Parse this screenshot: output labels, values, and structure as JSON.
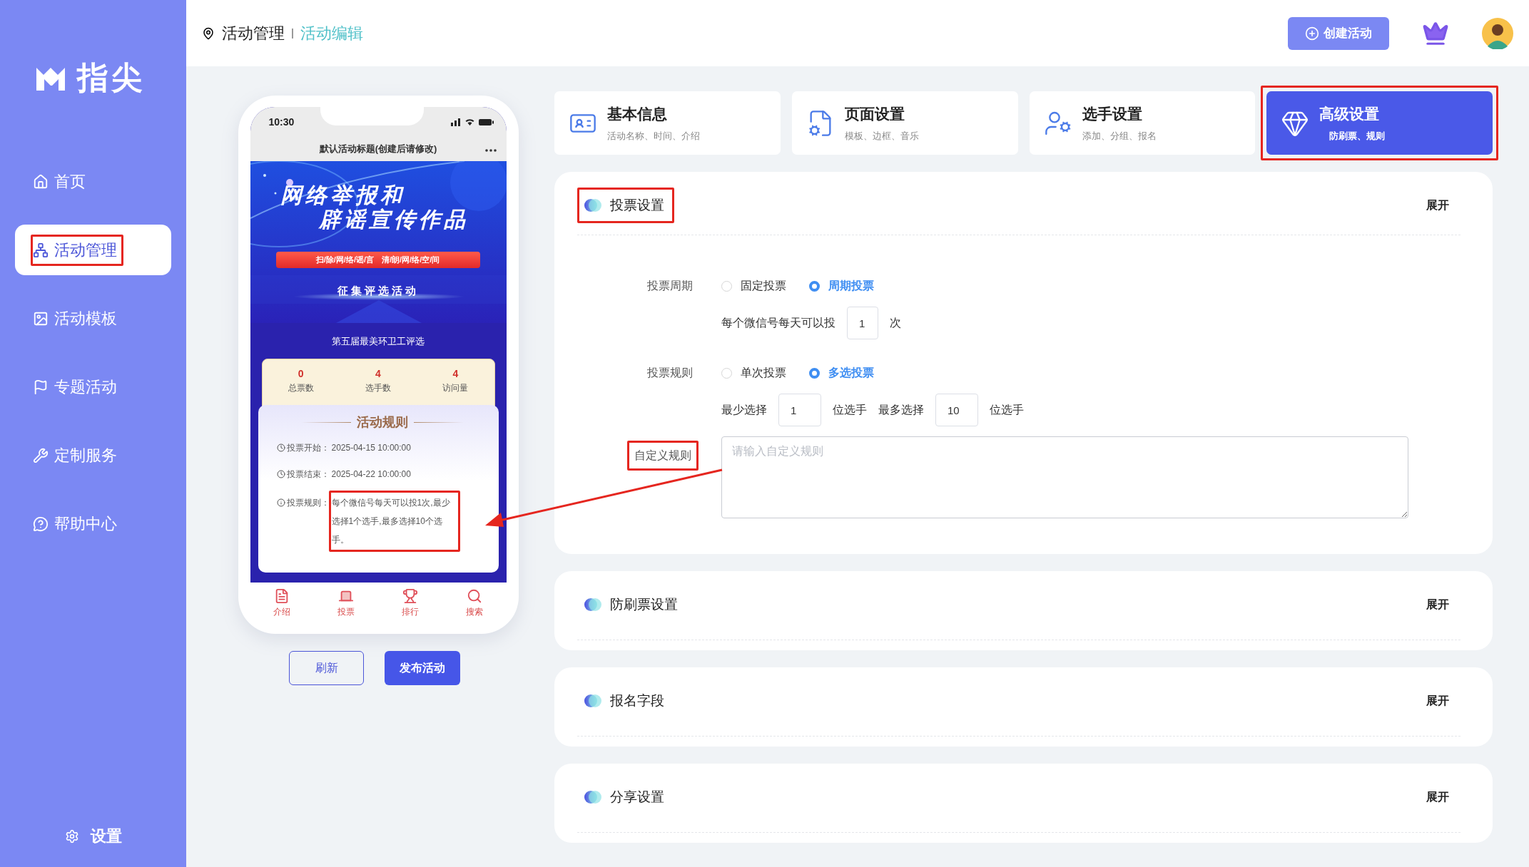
{
  "logo": {
    "text": "指尖"
  },
  "sidebar": {
    "items": [
      {
        "label": "首页",
        "selected": false
      },
      {
        "label": "活动管理",
        "selected": true,
        "annotated": true
      },
      {
        "label": "活动模板",
        "selected": false
      },
      {
        "label": "专题活动",
        "selected": false
      },
      {
        "label": "定制服务",
        "selected": false
      },
      {
        "label": "帮助中心",
        "selected": false
      }
    ],
    "settings": "设置"
  },
  "breadcrumb": [
    "活动管理",
    "活动编辑"
  ],
  "header": {
    "create_button": "创建活动"
  },
  "phone": {
    "time": "10:30",
    "title": "默认活动标题(创建后请修改)",
    "banner": {
      "headline_1": "网络举报和",
      "headline_2": "辟谣宣传作品",
      "slogan": "扫/除/网/络/谣/言　清/朗/网/络/空/间",
      "subtitle": "征集评选活动"
    },
    "event_name": "第五届最美环卫工评选",
    "stats": [
      {
        "value": "0",
        "label": "总票数"
      },
      {
        "value": "4",
        "label": "选手数"
      },
      {
        "value": "4",
        "label": "访问量"
      }
    ],
    "rules_title": "活动规则",
    "rules": [
      {
        "label": "投票开始：",
        "value": "2025-04-15 10:00:00"
      },
      {
        "label": "投票结束：",
        "value": "2025-04-22 10:00:00"
      },
      {
        "label": "投票规则：",
        "value": "每个微信号每天可以投1次,最少选择1个选手,最多选择10个选手。",
        "annotated": true
      }
    ],
    "nav": [
      {
        "label": "介绍",
        "selected": false
      },
      {
        "label": "投票",
        "selected": true
      },
      {
        "label": "排行",
        "selected": false
      },
      {
        "label": "搜索",
        "selected": false
      }
    ]
  },
  "actions": {
    "refresh": "刷新",
    "publish": "发布活动"
  },
  "steps": [
    {
      "title": "基本信息",
      "subtitle": "活动名称、时间、介绍",
      "selected": false
    },
    {
      "title": "页面设置",
      "subtitle": "模板、边框、音乐",
      "selected": false
    },
    {
      "title": "选手设置",
      "subtitle": "添加、分组、报名",
      "selected": false
    },
    {
      "title": "高级设置",
      "subtitle": "防刷票、规则",
      "selected": true,
      "annotated": true
    }
  ],
  "vote_settings": {
    "title": "投票设置",
    "toggle": "展开",
    "annotated": true,
    "period": {
      "label": "投票周期",
      "options": [
        {
          "label": "固定投票",
          "selected": false
        },
        {
          "label": "周期投票",
          "selected": true
        }
      ],
      "prefix": "每个微信号每天可以投",
      "value": "1",
      "suffix": "次"
    },
    "rule": {
      "label": "投票规则",
      "options": [
        {
          "label": "单次投票",
          "selected": false
        },
        {
          "label": "多选投票",
          "selected": true
        }
      ],
      "min_label": "最少选择",
      "min_value": "1",
      "min_suffix": "位选手",
      "max_label": "最多选择",
      "max_value": "10",
      "max_suffix": "位选手"
    },
    "custom": {
      "label": "自定义规则",
      "placeholder": "请输入自定义规则",
      "annotated": true
    }
  },
  "sections": [
    {
      "title": "防刷票设置",
      "toggle": "展开"
    },
    {
      "title": "报名字段",
      "toggle": "展开"
    },
    {
      "title": "分享设置",
      "toggle": "展开"
    }
  ],
  "callout_arrow": true
}
